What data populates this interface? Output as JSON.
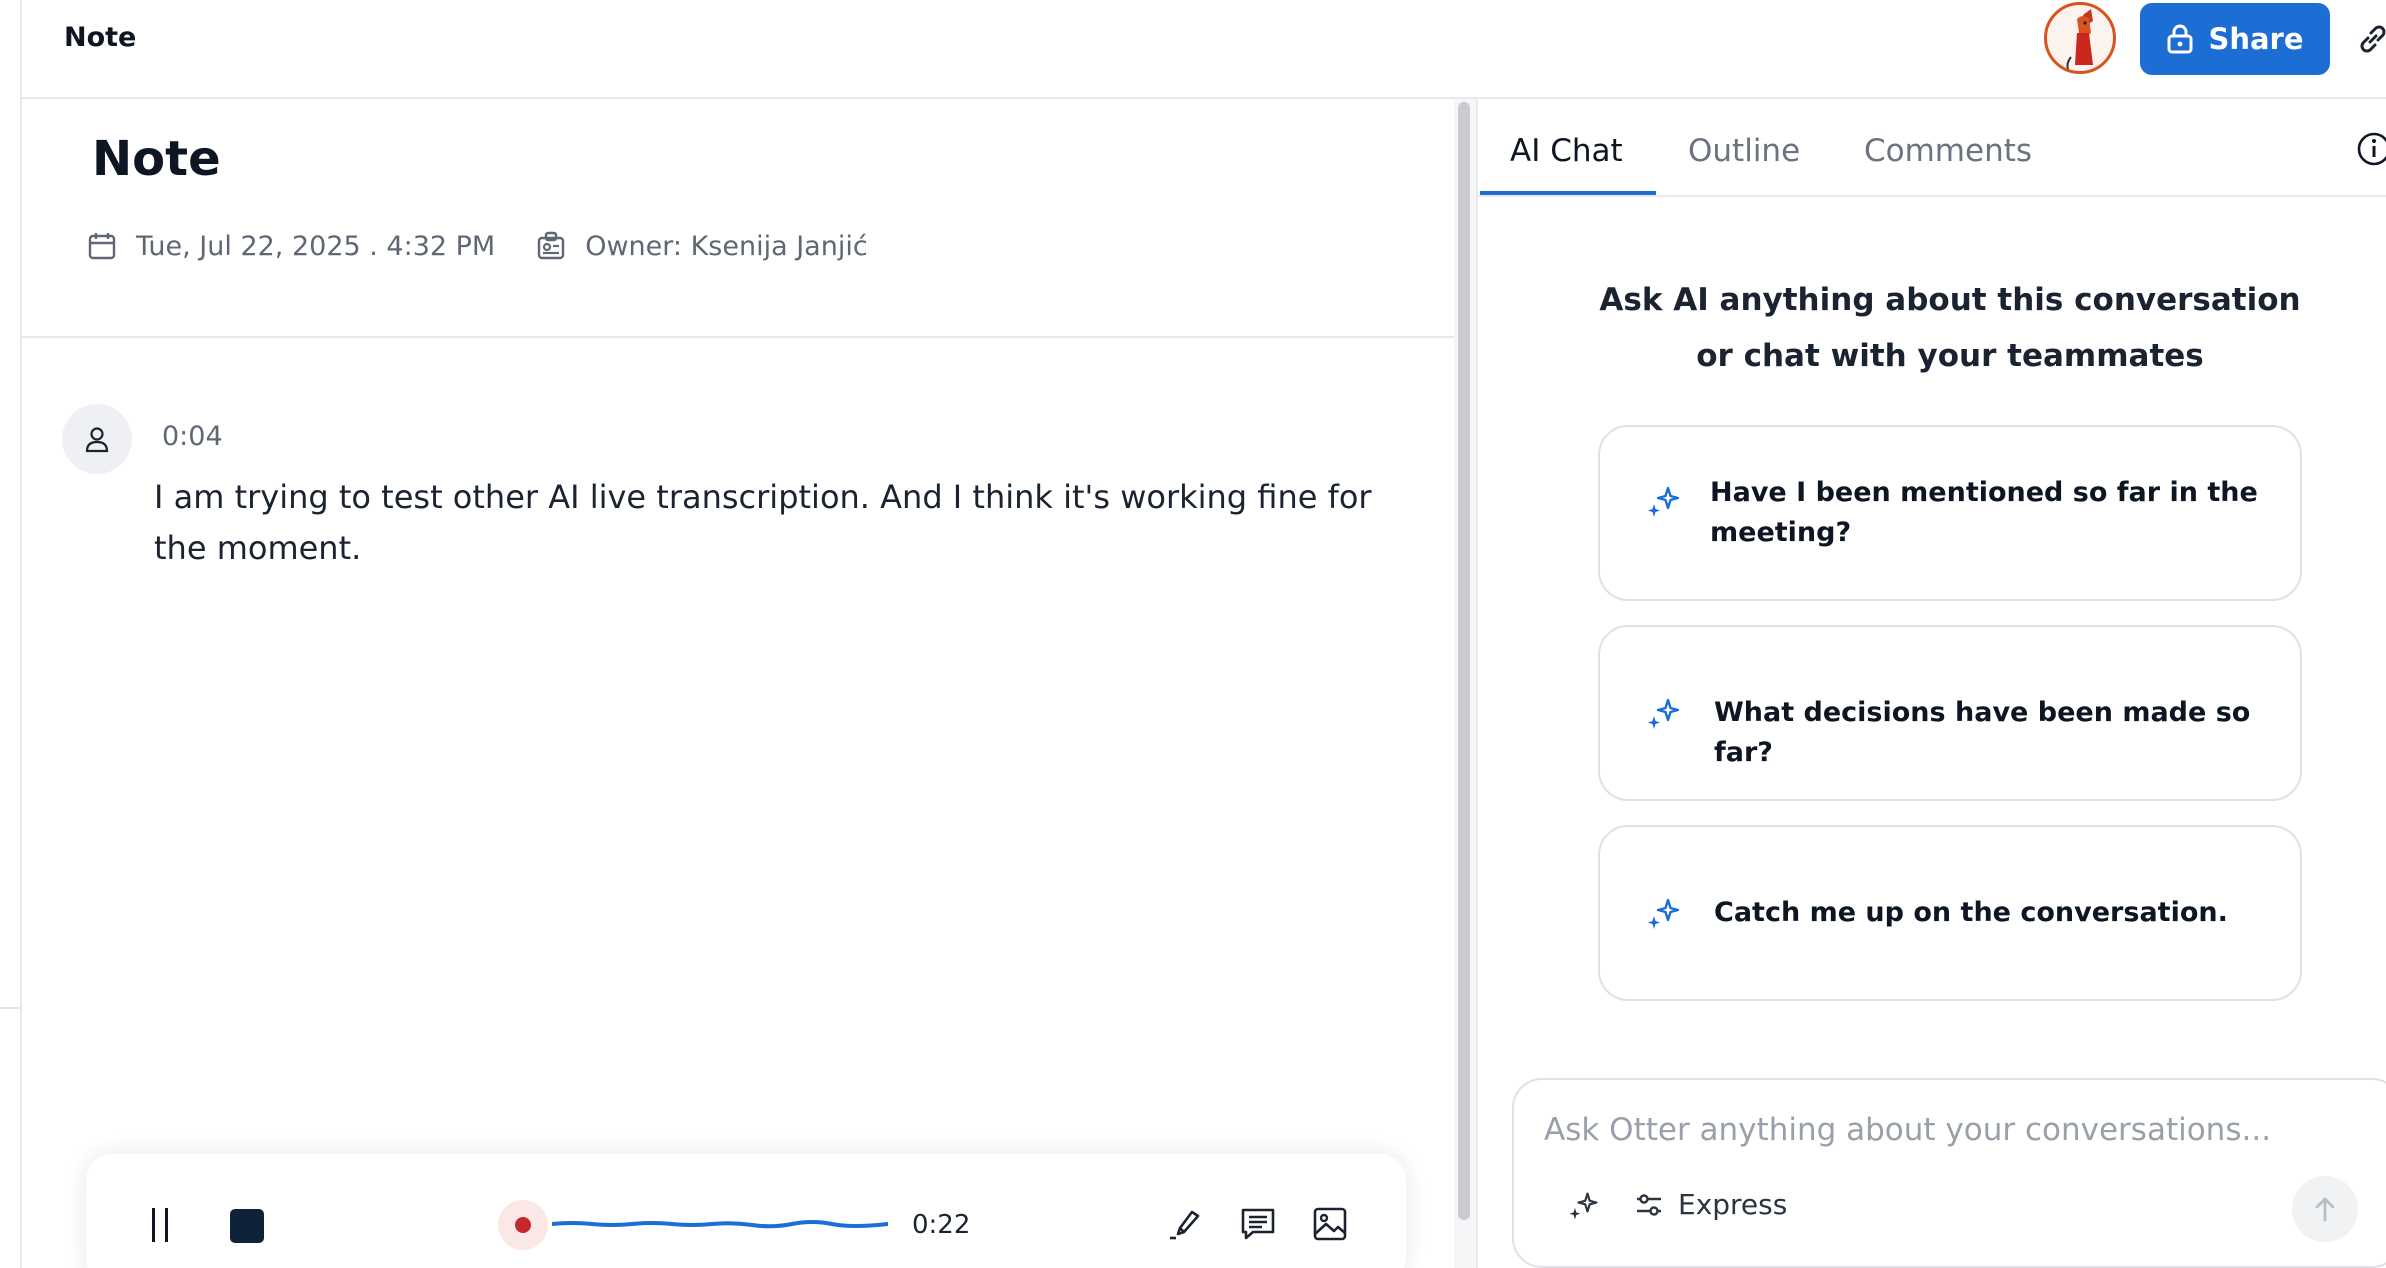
{
  "topbar": {
    "title": "Note",
    "share_label": "Share"
  },
  "note": {
    "title": "Note",
    "date": "Tue, Jul 22, 2025 . 4:32 PM",
    "owner": "Owner: Ksenija Janjić"
  },
  "transcript": {
    "time": "0:04",
    "text": "I am trying to test other AI live transcription. And I think it's working fine for the moment."
  },
  "player": {
    "elapsed": "0:22"
  },
  "panel": {
    "tabs": [
      {
        "label": "AI Chat",
        "active": true
      },
      {
        "label": "Outline",
        "active": false
      },
      {
        "label": "Comments",
        "active": false
      }
    ],
    "heading_line1": "Ask AI anything about this conversation",
    "heading_line2": "or chat with your teammates",
    "suggestions": [
      {
        "text": "Have I been mentioned so far in the meeting?"
      },
      {
        "text": "What decisions have been made so far?"
      },
      {
        "text": "Catch me up on the conversation."
      }
    ],
    "input_placeholder": "Ask Otter anything about your conversations...",
    "express_label": "Express"
  },
  "colors": {
    "accent": "#1c6ed4",
    "record": "#c6262c",
    "text_dark": "#0e1623"
  }
}
